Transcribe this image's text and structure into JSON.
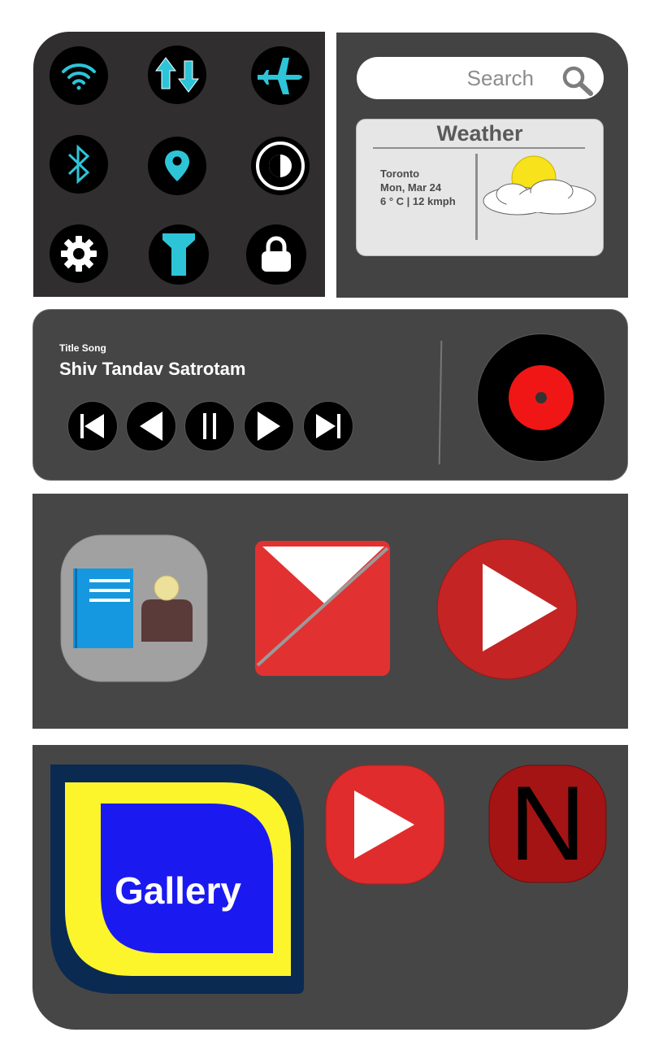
{
  "quick_settings": {
    "toggles": [
      {
        "name": "wifi",
        "icon": "wifi-icon"
      },
      {
        "name": "mobile-data",
        "icon": "data-transfer-icon"
      },
      {
        "name": "airplane-mode",
        "icon": "airplane-icon"
      },
      {
        "name": "bluetooth",
        "icon": "bluetooth-icon"
      },
      {
        "name": "location",
        "icon": "location-pin-icon"
      },
      {
        "name": "dark-mode",
        "icon": "contrast-icon"
      },
      {
        "name": "settings",
        "icon": "gear-icon"
      },
      {
        "name": "flashlight",
        "icon": "flashlight-icon"
      },
      {
        "name": "screen-lock",
        "icon": "lock-icon"
      }
    ],
    "accent_color": "#2ec4d8"
  },
  "search": {
    "placeholder": "Search",
    "icon": "search-icon"
  },
  "weather": {
    "title": "Weather",
    "city": "Toronto",
    "date": "Mon, Mar 24",
    "conditions": "6 ° C | 12 kmph",
    "icon": "partly-cloudy-icon"
  },
  "music_player": {
    "caption": "Title Song",
    "song": "Shiv Tandav Satrotam",
    "controls": [
      "skip-previous",
      "rewind",
      "pause",
      "play",
      "skip-next"
    ],
    "record_color": "#f01616"
  },
  "apps_row1": [
    {
      "name": "contacts",
      "icon": "contacts-icon"
    },
    {
      "name": "mail",
      "icon": "mail-icon"
    },
    {
      "name": "video-player",
      "icon": "play-icon"
    }
  ],
  "apps_row2": {
    "gallery": {
      "label": "Gallery",
      "icon": "gallery-icon"
    },
    "youtube": {
      "icon": "play-icon"
    },
    "netflix": {
      "letter": "N",
      "icon": "netflix-icon"
    }
  }
}
